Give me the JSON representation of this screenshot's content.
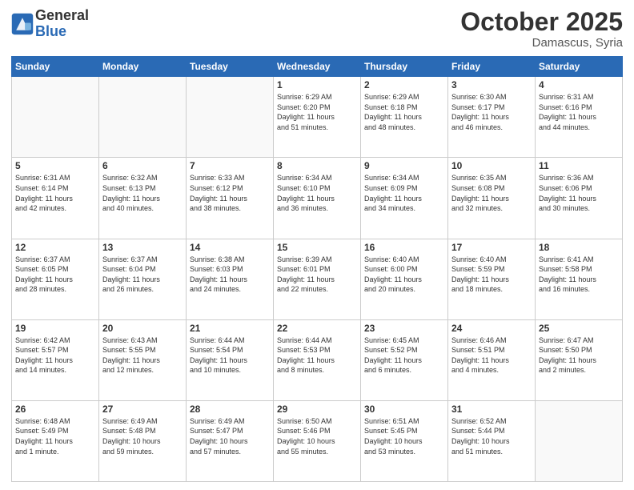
{
  "logo": {
    "general": "General",
    "blue": "Blue"
  },
  "header": {
    "month": "October 2025",
    "location": "Damascus, Syria"
  },
  "weekdays": [
    "Sunday",
    "Monday",
    "Tuesday",
    "Wednesday",
    "Thursday",
    "Friday",
    "Saturday"
  ],
  "weeks": [
    [
      {
        "day": "",
        "info": ""
      },
      {
        "day": "",
        "info": ""
      },
      {
        "day": "",
        "info": ""
      },
      {
        "day": "1",
        "info": "Sunrise: 6:29 AM\nSunset: 6:20 PM\nDaylight: 11 hours\nand 51 minutes."
      },
      {
        "day": "2",
        "info": "Sunrise: 6:29 AM\nSunset: 6:18 PM\nDaylight: 11 hours\nand 48 minutes."
      },
      {
        "day": "3",
        "info": "Sunrise: 6:30 AM\nSunset: 6:17 PM\nDaylight: 11 hours\nand 46 minutes."
      },
      {
        "day": "4",
        "info": "Sunrise: 6:31 AM\nSunset: 6:16 PM\nDaylight: 11 hours\nand 44 minutes."
      }
    ],
    [
      {
        "day": "5",
        "info": "Sunrise: 6:31 AM\nSunset: 6:14 PM\nDaylight: 11 hours\nand 42 minutes."
      },
      {
        "day": "6",
        "info": "Sunrise: 6:32 AM\nSunset: 6:13 PM\nDaylight: 11 hours\nand 40 minutes."
      },
      {
        "day": "7",
        "info": "Sunrise: 6:33 AM\nSunset: 6:12 PM\nDaylight: 11 hours\nand 38 minutes."
      },
      {
        "day": "8",
        "info": "Sunrise: 6:34 AM\nSunset: 6:10 PM\nDaylight: 11 hours\nand 36 minutes."
      },
      {
        "day": "9",
        "info": "Sunrise: 6:34 AM\nSunset: 6:09 PM\nDaylight: 11 hours\nand 34 minutes."
      },
      {
        "day": "10",
        "info": "Sunrise: 6:35 AM\nSunset: 6:08 PM\nDaylight: 11 hours\nand 32 minutes."
      },
      {
        "day": "11",
        "info": "Sunrise: 6:36 AM\nSunset: 6:06 PM\nDaylight: 11 hours\nand 30 minutes."
      }
    ],
    [
      {
        "day": "12",
        "info": "Sunrise: 6:37 AM\nSunset: 6:05 PM\nDaylight: 11 hours\nand 28 minutes."
      },
      {
        "day": "13",
        "info": "Sunrise: 6:37 AM\nSunset: 6:04 PM\nDaylight: 11 hours\nand 26 minutes."
      },
      {
        "day": "14",
        "info": "Sunrise: 6:38 AM\nSunset: 6:03 PM\nDaylight: 11 hours\nand 24 minutes."
      },
      {
        "day": "15",
        "info": "Sunrise: 6:39 AM\nSunset: 6:01 PM\nDaylight: 11 hours\nand 22 minutes."
      },
      {
        "day": "16",
        "info": "Sunrise: 6:40 AM\nSunset: 6:00 PM\nDaylight: 11 hours\nand 20 minutes."
      },
      {
        "day": "17",
        "info": "Sunrise: 6:40 AM\nSunset: 5:59 PM\nDaylight: 11 hours\nand 18 minutes."
      },
      {
        "day": "18",
        "info": "Sunrise: 6:41 AM\nSunset: 5:58 PM\nDaylight: 11 hours\nand 16 minutes."
      }
    ],
    [
      {
        "day": "19",
        "info": "Sunrise: 6:42 AM\nSunset: 5:57 PM\nDaylight: 11 hours\nand 14 minutes."
      },
      {
        "day": "20",
        "info": "Sunrise: 6:43 AM\nSunset: 5:55 PM\nDaylight: 11 hours\nand 12 minutes."
      },
      {
        "day": "21",
        "info": "Sunrise: 6:44 AM\nSunset: 5:54 PM\nDaylight: 11 hours\nand 10 minutes."
      },
      {
        "day": "22",
        "info": "Sunrise: 6:44 AM\nSunset: 5:53 PM\nDaylight: 11 hours\nand 8 minutes."
      },
      {
        "day": "23",
        "info": "Sunrise: 6:45 AM\nSunset: 5:52 PM\nDaylight: 11 hours\nand 6 minutes."
      },
      {
        "day": "24",
        "info": "Sunrise: 6:46 AM\nSunset: 5:51 PM\nDaylight: 11 hours\nand 4 minutes."
      },
      {
        "day": "25",
        "info": "Sunrise: 6:47 AM\nSunset: 5:50 PM\nDaylight: 11 hours\nand 2 minutes."
      }
    ],
    [
      {
        "day": "26",
        "info": "Sunrise: 6:48 AM\nSunset: 5:49 PM\nDaylight: 11 hours\nand 1 minute."
      },
      {
        "day": "27",
        "info": "Sunrise: 6:49 AM\nSunset: 5:48 PM\nDaylight: 10 hours\nand 59 minutes."
      },
      {
        "day": "28",
        "info": "Sunrise: 6:49 AM\nSunset: 5:47 PM\nDaylight: 10 hours\nand 57 minutes."
      },
      {
        "day": "29",
        "info": "Sunrise: 6:50 AM\nSunset: 5:46 PM\nDaylight: 10 hours\nand 55 minutes."
      },
      {
        "day": "30",
        "info": "Sunrise: 6:51 AM\nSunset: 5:45 PM\nDaylight: 10 hours\nand 53 minutes."
      },
      {
        "day": "31",
        "info": "Sunrise: 6:52 AM\nSunset: 5:44 PM\nDaylight: 10 hours\nand 51 minutes."
      },
      {
        "day": "",
        "info": ""
      }
    ]
  ]
}
